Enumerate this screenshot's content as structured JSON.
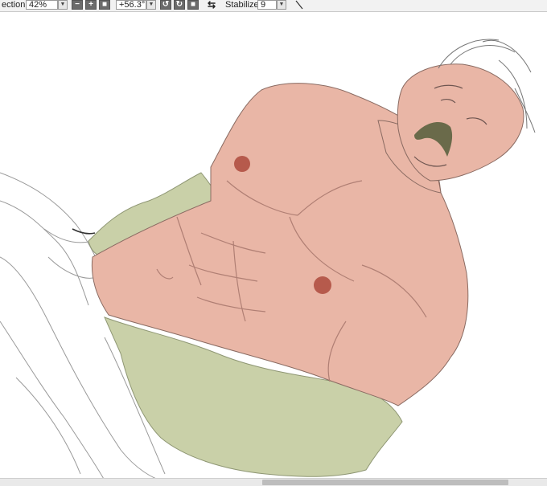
{
  "toolbar": {
    "correction_label": "ection",
    "zoom_value": "42%",
    "angle_value": "+56.3°",
    "stabilizer_label": "Stabilizer",
    "stabilizer_value": "9",
    "zoom_out_symbol": "−",
    "zoom_in_symbol": "+",
    "fit_symbol": "■",
    "rotate_left_symbol": "↺",
    "rotate_right_symbol": "↻",
    "reset_rotation_symbol": "■",
    "flip_symbol": "⇆",
    "dropdown_symbol": "▼"
  },
  "colors": {
    "skin": "#e9b6a6",
    "shirt": "#c9d0a8",
    "nipple": "#b65a4c",
    "mustache": "#6a6a4a",
    "line": "#8a6b62"
  }
}
